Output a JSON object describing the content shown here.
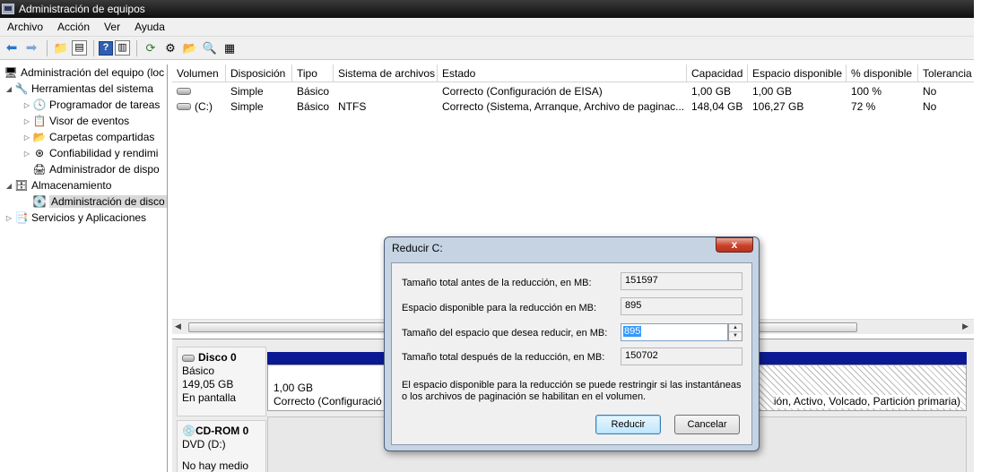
{
  "window": {
    "title": "Administración de equipos"
  },
  "menu": [
    "Archivo",
    "Acción",
    "Ver",
    "Ayuda"
  ],
  "toolbar_icons": [
    "back-arrow-icon",
    "forward-arrow-icon",
    "up-folder-icon",
    "show-hide-tree-icon",
    "help-icon",
    "show-hide-action-pane-icon",
    "refresh-icon",
    "properties-icon",
    "open-folder-icon",
    "search-icon",
    "export-icon"
  ],
  "tree": {
    "root": "Administración del equipo (loc",
    "items": [
      {
        "label": "Herramientas del sistema",
        "level": 1,
        "expander": "open",
        "icon": "tools-icon"
      },
      {
        "label": "Programador de tareas",
        "level": 2,
        "expander": "closed",
        "icon": "clock-icon"
      },
      {
        "label": "Visor de eventos",
        "level": 2,
        "expander": "closed",
        "icon": "event-viewer-icon"
      },
      {
        "label": "Carpetas compartidas",
        "level": 2,
        "expander": "closed",
        "icon": "shared-folder-icon"
      },
      {
        "label": "Confiabilidad y rendimi",
        "level": 2,
        "expander": "closed",
        "icon": "reliability-icon"
      },
      {
        "label": "Administrador de dispo",
        "level": 2,
        "expander": "none",
        "icon": "device-manager-icon"
      },
      {
        "label": "Almacenamiento",
        "level": 1,
        "expander": "open",
        "icon": "storage-icon"
      },
      {
        "label": "Administración de disco",
        "level": 2,
        "expander": "none",
        "icon": "disk-management-icon",
        "selected": true
      },
      {
        "label": "Servicios y Aplicaciones",
        "level": 1,
        "expander": "closed",
        "icon": "services-icon"
      }
    ]
  },
  "table": {
    "columns": [
      "Volumen",
      "Disposición",
      "Tipo",
      "Sistema de archivos",
      "Estado",
      "Capacidad",
      "Espacio disponible",
      "% disponible",
      "Tolerancia"
    ],
    "rows": [
      [
        "",
        "Simple",
        "Básico",
        "",
        "Correcto (Configuración de EISA)",
        "1,00 GB",
        "1,00 GB",
        "100 %",
        "No"
      ],
      [
        "(C:)",
        "Simple",
        "Básico",
        "NTFS",
        "Correcto (Sistema, Arranque, Archivo de paginac...",
        "148,04 GB",
        "106,27 GB",
        "72 %",
        "No"
      ]
    ]
  },
  "disks": {
    "disk0": {
      "name": "Disco 0",
      "type": "Básico",
      "size": "149,05 GB",
      "status": "En pantalla"
    },
    "partition1": {
      "size": "1,00 GB",
      "status": "Correcto (Configuració"
    },
    "partition2": {
      "status": "ión, Activo, Volcado, Partición primaria)"
    },
    "cdrom": {
      "name": "CD-ROM 0",
      "drive": "DVD (D:)",
      "status": "No hay medio"
    }
  },
  "dialog": {
    "title": "Reducir C:",
    "close": "x",
    "total_before_label": "Tamaño total antes de la reducción, en MB:",
    "total_before_value": "151597",
    "available_label": "Espacio disponible para la reducción en MB:",
    "available_value": "895",
    "shrink_label": "Tamaño del espacio que desea reducir, en MB:",
    "shrink_value": "895",
    "total_after_label": "Tamaño total después de la reducción, en MB:",
    "total_after_value": "150702",
    "note": "El espacio disponible para la reducción se puede restringir si las instantáneas o los archivos de paginación se habilitan en el volumen.",
    "ok_label": "Reducir",
    "cancel_label": "Cancelar"
  },
  "colors": {
    "primary_partition_bar": "#0b1a94",
    "selection": "#3399ff",
    "close_button": "#c9412b"
  }
}
